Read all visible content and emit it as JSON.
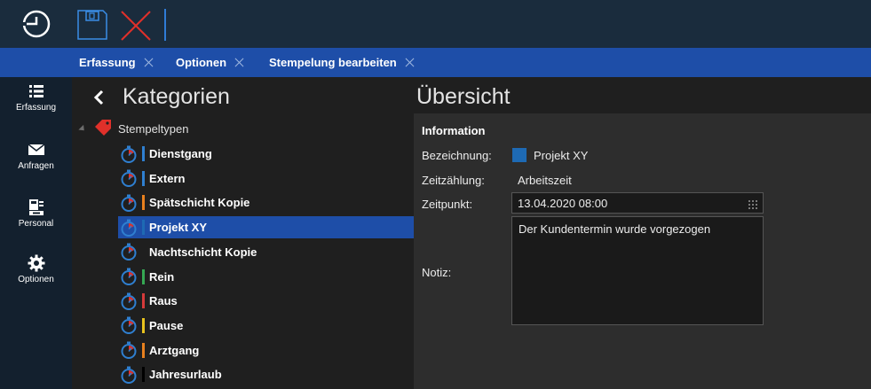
{
  "tabs": [
    {
      "label": "Erfassung"
    },
    {
      "label": "Optionen"
    },
    {
      "label": "Stempelung bearbeiten"
    }
  ],
  "nav": [
    {
      "label": "Erfassung",
      "icon": "list-icon"
    },
    {
      "label": "Anfragen",
      "icon": "envelope-icon"
    },
    {
      "label": "Personal",
      "icon": "personnel-icon"
    },
    {
      "label": "Optionen",
      "icon": "gear-icon"
    }
  ],
  "categories": {
    "title": "Kategorien",
    "root_label": "Stempeltypen",
    "items": [
      {
        "label": "Dienstgang",
        "color": "#2f7fd0",
        "selected": false
      },
      {
        "label": "Extern",
        "color": "#2f7fd0",
        "selected": false
      },
      {
        "label": "Spätschicht Kopie",
        "color": "#e8801e",
        "selected": false
      },
      {
        "label": "Projekt XY",
        "color": "#1e6ab4",
        "selected": true
      },
      {
        "label": "Nachtschicht Kopie",
        "color": "#1f1f1f",
        "selected": false
      },
      {
        "label": "Rein",
        "color": "#35a853",
        "selected": false
      },
      {
        "label": "Raus",
        "color": "#d63a3a",
        "selected": false
      },
      {
        "label": "Pause",
        "color": "#e8c21e",
        "selected": false
      },
      {
        "label": "Arztgang",
        "color": "#e8801e",
        "selected": false
      },
      {
        "label": "Jahresurlaub",
        "color": "#000000",
        "selected": false
      }
    ]
  },
  "overview": {
    "title": "Übersicht",
    "section": "Information",
    "bezeichnung_label": "Bezeichnung:",
    "bezeichnung_value": "Projekt XY",
    "bezeichnung_color": "#1e6ab4",
    "zeitzaehlung_label": "Zeitzählung:",
    "zeitzaehlung_value": "Arbeitszeit",
    "zeitpunkt_label": "Zeitpunkt:",
    "zeitpunkt_value": "13.04.2020 08:00",
    "notiz_label": "Notiz:",
    "notiz_value": "Der Kundentermin wurde vorgezogen"
  }
}
